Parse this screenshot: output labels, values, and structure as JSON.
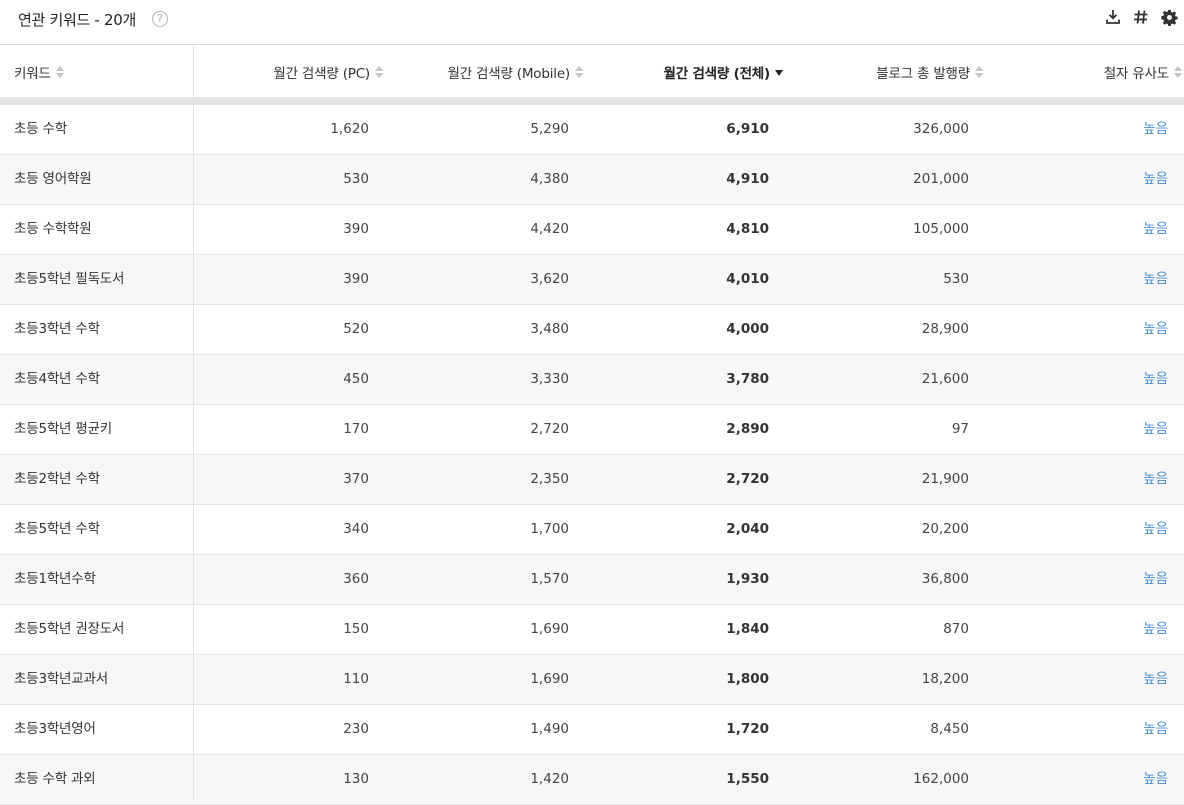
{
  "header": {
    "title": "연관 키워드 - 20개",
    "help_glyph": "?"
  },
  "toolbar": {
    "icons": [
      "download-icon",
      "hashtag-icon",
      "gear-icon"
    ]
  },
  "table": {
    "columns": [
      {
        "label": "키워드",
        "sort": "none"
      },
      {
        "label": "월간 검색량 (PC)",
        "sort": "none"
      },
      {
        "label": "월간 검색량 (Mobile)",
        "sort": "none"
      },
      {
        "label": "월간 검색량 (전체)",
        "sort": "desc"
      },
      {
        "label": "블로그 총 발행량",
        "sort": "none"
      },
      {
        "label": "철자 유사도",
        "sort": "none"
      }
    ],
    "rows": [
      {
        "keyword": "초등 수학",
        "pc": "1,620",
        "mobile": "5,290",
        "total": "6,910",
        "blog": "326,000",
        "similarity": "높음"
      },
      {
        "keyword": "초등 영어학원",
        "pc": "530",
        "mobile": "4,380",
        "total": "4,910",
        "blog": "201,000",
        "similarity": "높음"
      },
      {
        "keyword": "초등 수학학원",
        "pc": "390",
        "mobile": "4,420",
        "total": "4,810",
        "blog": "105,000",
        "similarity": "높음"
      },
      {
        "keyword": "초등5학년 필독도서",
        "pc": "390",
        "mobile": "3,620",
        "total": "4,010",
        "blog": "530",
        "similarity": "높음"
      },
      {
        "keyword": "초등3학년 수학",
        "pc": "520",
        "mobile": "3,480",
        "total": "4,000",
        "blog": "28,900",
        "similarity": "높음"
      },
      {
        "keyword": "초등4학년 수학",
        "pc": "450",
        "mobile": "3,330",
        "total": "3,780",
        "blog": "21,600",
        "similarity": "높음"
      },
      {
        "keyword": "초등5학년 평균키",
        "pc": "170",
        "mobile": "2,720",
        "total": "2,890",
        "blog": "97",
        "similarity": "높음"
      },
      {
        "keyword": "초등2학년 수학",
        "pc": "370",
        "mobile": "2,350",
        "total": "2,720",
        "blog": "21,900",
        "similarity": "높음"
      },
      {
        "keyword": "초등5학년 수학",
        "pc": "340",
        "mobile": "1,700",
        "total": "2,040",
        "blog": "20,200",
        "similarity": "높음"
      },
      {
        "keyword": "초등1학년수학",
        "pc": "360",
        "mobile": "1,570",
        "total": "1,930",
        "blog": "36,800",
        "similarity": "높음"
      },
      {
        "keyword": "초등5학년 권장도서",
        "pc": "150",
        "mobile": "1,690",
        "total": "1,840",
        "blog": "870",
        "similarity": "높음"
      },
      {
        "keyword": "초등3학년교과서",
        "pc": "110",
        "mobile": "1,690",
        "total": "1,800",
        "blog": "18,200",
        "similarity": "높음"
      },
      {
        "keyword": "초등3학년영어",
        "pc": "230",
        "mobile": "1,490",
        "total": "1,720",
        "blog": "8,450",
        "similarity": "높음"
      },
      {
        "keyword": "초등 수학 과외",
        "pc": "130",
        "mobile": "1,420",
        "total": "1,550",
        "blog": "162,000",
        "similarity": "높음"
      }
    ]
  },
  "colors": {
    "link": "#4a90d9",
    "header_band": "#e4e4e4",
    "row_alt": "#f7f7f7"
  }
}
